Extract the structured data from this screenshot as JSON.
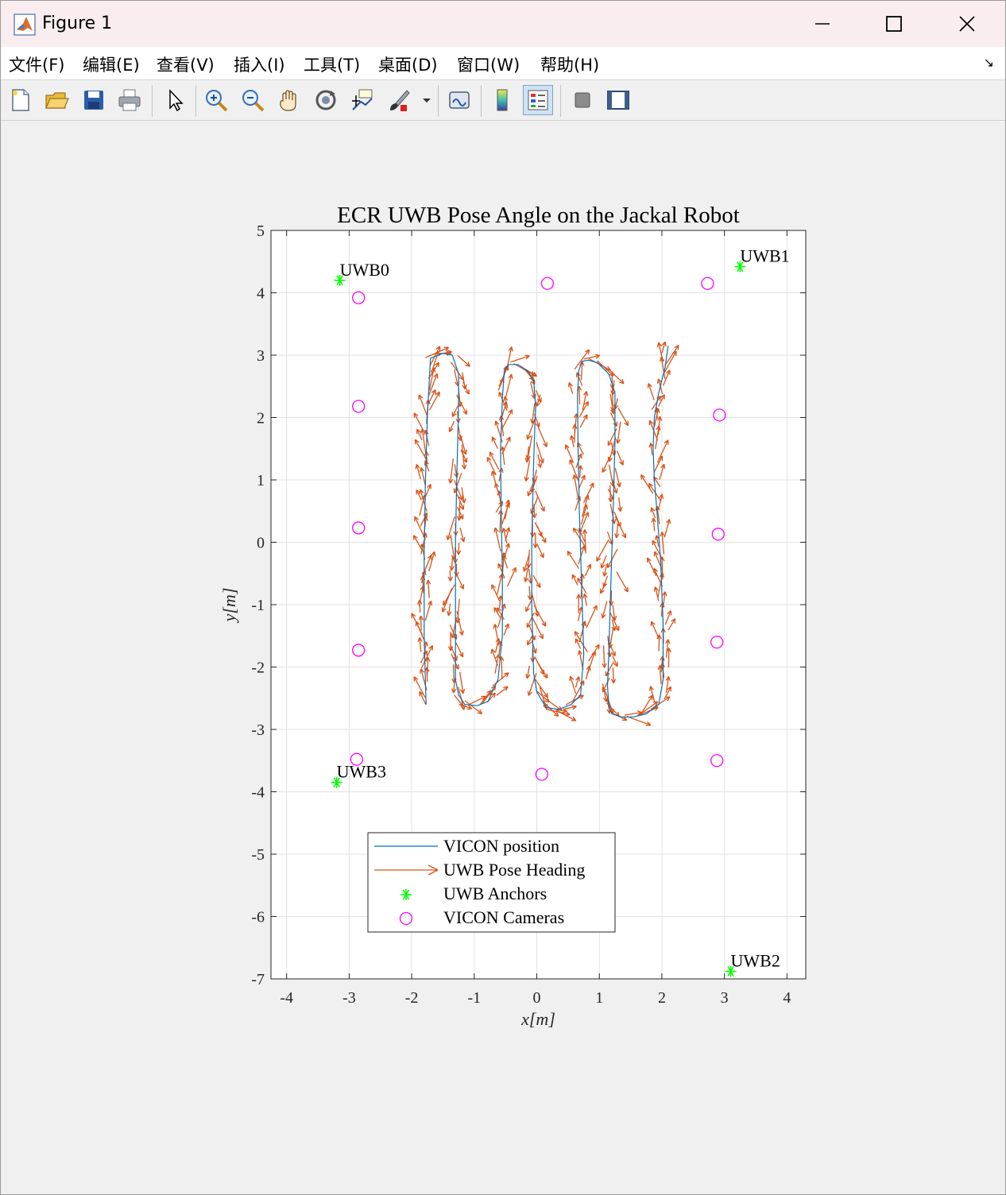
{
  "window": {
    "title": "Figure 1"
  },
  "menu": {
    "items": [
      "文件(F)",
      "编辑(E)",
      "查看(V)",
      "插入(I)",
      "工具(T)",
      "桌面(D)",
      "窗口(W)",
      "帮助(H)"
    ]
  },
  "toolbar": {
    "icons": [
      "new-figure-icon",
      "open-file-icon",
      "save-icon",
      "print-icon",
      "pointer-icon",
      "zoom-in-icon",
      "zoom-out-icon",
      "pan-hand-icon",
      "rotate-3d-icon",
      "data-cursor-icon",
      "brush-icon",
      "brush-dropdown-icon",
      "link-plot-icon",
      "colorbar-icon",
      "legend-icon",
      "hide-plot-tools-icon",
      "show-plot-tools-icon"
    ]
  },
  "colors": {
    "vicon": "#0072bd",
    "uwb_heading": "#d95319",
    "anchors": "#00ff00",
    "cameras": "#ff00ff",
    "titlebar": "#f9edef"
  },
  "chart_data": {
    "type": "line",
    "title": "ECR UWB Pose Angle on the Jackal Robot",
    "xlabel": "x[m]",
    "ylabel": "y[m]",
    "xlim": [
      -4.25,
      4.3
    ],
    "ylim": [
      -7,
      5
    ],
    "xticks": [
      -4,
      -3,
      -2,
      -1,
      0,
      1,
      2,
      3,
      4
    ],
    "yticks": [
      5,
      4,
      3,
      2,
      1,
      0,
      -1,
      -2,
      -3,
      -4,
      -5,
      -6,
      -7
    ],
    "grid": true,
    "legend": {
      "position": "bottom-left",
      "entries": [
        "VICON position",
        "UWB Pose Heading",
        "UWB Anchors",
        "VICON Cameras"
      ]
    },
    "vicon_position": {
      "x": [
        -1.77,
        -1.8,
        -1.8,
        -1.78,
        -1.75,
        -1.7,
        -1.5,
        -1.35,
        -1.25,
        -1.25,
        -1.28,
        -1.3,
        -1.3,
        -1.3,
        -1.3,
        -1.25,
        -1.15,
        -0.95,
        -0.78,
        -0.62,
        -0.55,
        -0.55,
        -0.57,
        -0.58,
        -0.55,
        -0.52,
        -0.45,
        -0.3,
        -0.15,
        -0.05,
        -0.02,
        -0.05,
        -0.08,
        -0.08,
        -0.06,
        -0.05,
        0.0,
        0.15,
        0.35,
        0.55,
        0.7,
        0.75,
        0.72,
        0.68,
        0.66,
        0.65,
        0.67,
        0.72,
        0.82,
        0.97,
        1.15,
        1.25,
        1.25,
        1.22,
        1.18,
        1.15,
        1.13,
        1.15,
        1.2,
        1.35,
        1.55,
        1.75,
        1.95,
        2.02,
        2.02,
        1.98,
        1.92,
        1.88,
        1.86,
        1.88,
        1.95,
        2.05,
        2.1
      ],
      "y": [
        -2.6,
        -1.5,
        -0.2,
        1.0,
        2.0,
        2.95,
        3.03,
        3.0,
        2.7,
        2.2,
        1.0,
        0.0,
        -1.0,
        -1.8,
        -2.2,
        -2.45,
        -2.6,
        -2.62,
        -2.55,
        -2.2,
        -1.5,
        -0.5,
        0.5,
        1.5,
        2.3,
        2.75,
        2.85,
        2.85,
        2.75,
        2.6,
        2.2,
        1.3,
        0.0,
        -1.0,
        -1.8,
        -2.1,
        -2.4,
        -2.65,
        -2.68,
        -2.6,
        -2.45,
        -1.8,
        -0.8,
        0.5,
        1.5,
        2.35,
        2.75,
        2.9,
        2.92,
        2.88,
        2.7,
        2.4,
        1.6,
        0.5,
        -0.8,
        -1.8,
        -2.3,
        -2.6,
        -2.75,
        -2.8,
        -2.8,
        -2.75,
        -2.6,
        -2.2,
        -1.3,
        -0.3,
        0.5,
        1.0,
        1.5,
        2.0,
        2.4,
        2.8,
        3.15
      ]
    },
    "uwb_anchors": [
      {
        "name": "UWB0",
        "x": -3.15,
        "y": 4.2
      },
      {
        "name": "UWB1",
        "x": 3.25,
        "y": 4.42
      },
      {
        "name": "UWB2",
        "x": 3.1,
        "y": -6.88
      },
      {
        "name": "UWB3",
        "x": -3.2,
        "y": -3.85
      }
    ],
    "vicon_cameras": [
      {
        "x": -2.85,
        "y": 3.92
      },
      {
        "x": 0.17,
        "y": 4.15
      },
      {
        "x": 2.73,
        "y": 4.15
      },
      {
        "x": -2.85,
        "y": 2.18
      },
      {
        "x": 2.92,
        "y": 2.04
      },
      {
        "x": -2.85,
        "y": 0.23
      },
      {
        "x": 2.9,
        "y": 0.13
      },
      {
        "x": -2.85,
        "y": -1.73
      },
      {
        "x": 2.88,
        "y": -1.6
      },
      {
        "x": -2.88,
        "y": -3.48
      },
      {
        "x": 0.08,
        "y": -3.72
      },
      {
        "x": 2.88,
        "y": -3.5
      }
    ]
  }
}
